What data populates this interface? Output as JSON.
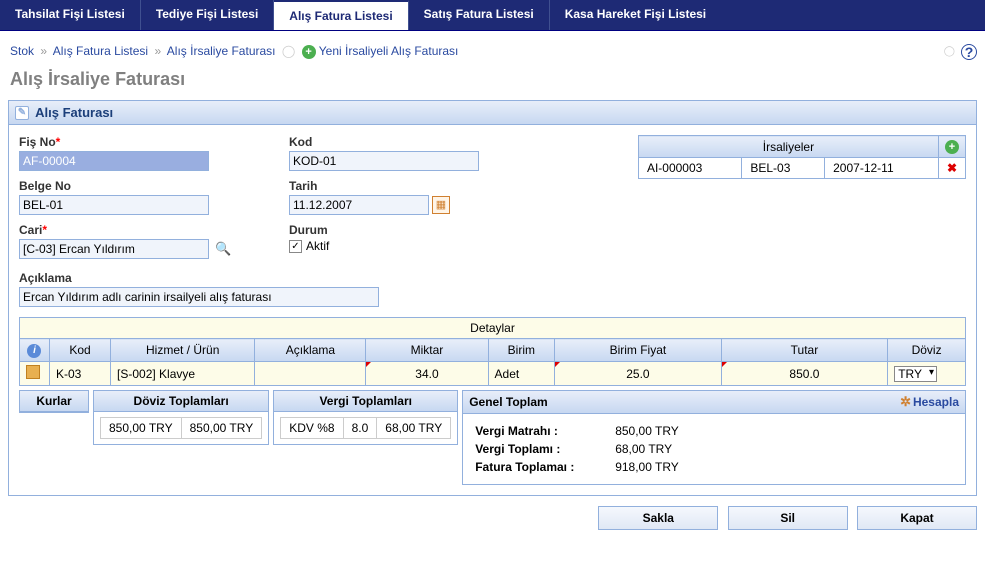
{
  "tabs": {
    "t0": "Tahsilat Fişi Listesi",
    "t1": "Tediye Fişi Listesi",
    "t2": "Alış Fatura Listesi",
    "t3": "Satış Fatura Listesi",
    "t4": "Kasa Hareket Fişi Listesi"
  },
  "breadcrumb": {
    "b0": "Stok",
    "b1": "Alış Fatura Listesi",
    "b2": "Alış İrsaliye Faturası",
    "b3": "Yeni İrsaliyeli Alış Faturası"
  },
  "page_title": "Alış İrsaliye Faturası",
  "panel_title": "Alış Faturası",
  "form": {
    "fis_no": {
      "label": "Fiş No",
      "required": "*",
      "value": "AF-00004"
    },
    "belge_no": {
      "label": "Belge No",
      "value": "BEL-01"
    },
    "cari": {
      "label": "Cari",
      "required": "*",
      "value": "[C-03] Ercan Yıldırım"
    },
    "kod": {
      "label": "Kod",
      "value": "KOD-01"
    },
    "tarih": {
      "label": "Tarih",
      "value": "11.12.2007"
    },
    "durum": {
      "label": "Durum",
      "option": "Aktif"
    },
    "aciklama": {
      "label": "Açıklama",
      "value": "Ercan Yıldırım adlı carinin irsailyeli alış faturası"
    }
  },
  "irsaliyeler": {
    "title": "İrsaliyeler",
    "row": {
      "c0": "AI-000003",
      "c1": "BEL-03",
      "c2": "2007-12-11"
    }
  },
  "detaylar": {
    "title": "Detaylar",
    "headers": {
      "kod": "Kod",
      "hizmet": "Hizmet / Ürün",
      "aciklama": "Açıklama",
      "miktar": "Miktar",
      "birim": "Birim",
      "birim_fiyat": "Birim Fiyat",
      "tutar": "Tutar",
      "doviz": "Döviz"
    },
    "row": {
      "kod": "K-03",
      "hizmet": "[S-002] Klavye",
      "aciklama": "",
      "miktar": "34.0",
      "birim": "Adet",
      "birim_fiyat": "25.0",
      "tutar": "850.0",
      "doviz": "TRY"
    }
  },
  "kurlar_label": "Kurlar",
  "doviz_top": {
    "title": "Döviz Toplamları",
    "c0": "850,00 TRY",
    "c1": "850,00 TRY"
  },
  "vergi_top": {
    "title": "Vergi Toplamları",
    "c0": "KDV %8",
    "c1": "8.0",
    "c2": "68,00 TRY"
  },
  "genel": {
    "title": "Genel Toplam",
    "hesapla": "Hesapla",
    "matrah_lbl": "Vergi Matrahı :",
    "matrah_val": "850,00 TRY",
    "vergi_lbl": "Vergi Toplamı :",
    "vergi_val": "68,00 TRY",
    "fatura_lbl": "Fatura Toplamaı :",
    "fatura_val": "918,00 TRY"
  },
  "actions": {
    "sakla": "Sakla",
    "sil": "Sil",
    "kapat": "Kapat"
  }
}
